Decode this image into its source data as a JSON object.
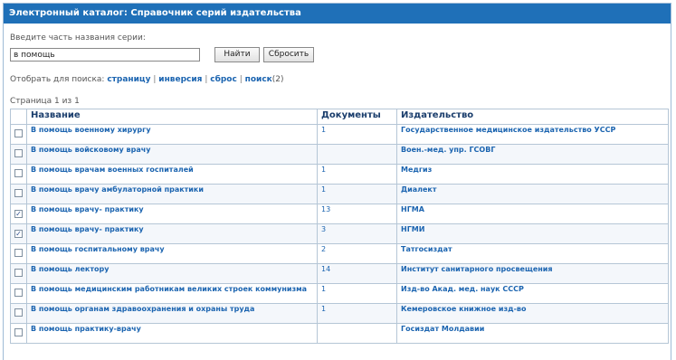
{
  "window": {
    "title": "Электронный каталог: Справочник серий издательства"
  },
  "search": {
    "label": "Введите часть названия серии:",
    "value": "в помощь",
    "find_label": "Найти",
    "reset_label": "Сбросить"
  },
  "filter": {
    "prefix": "Отобрать для поиска:",
    "links": [
      "страницу",
      "инверсия",
      "сброс",
      "поиск"
    ],
    "search_count": "(2)"
  },
  "pagination": {
    "label": "Страница 1 из 1"
  },
  "table": {
    "headers": [
      "Название",
      "Документы",
      "Издательство"
    ],
    "rows": [
      {
        "checked": false,
        "name": "В помощь военному хирургу",
        "docs": "1",
        "publisher": "Государственное медицинское издательство УССР"
      },
      {
        "checked": false,
        "name": "В помощь войсковому врачу",
        "docs": "",
        "publisher": "Воен.-мед. упр. ГСОВГ"
      },
      {
        "checked": false,
        "name": "В помощь врачам военных госпиталей",
        "docs": "1",
        "publisher": "Медгиз"
      },
      {
        "checked": false,
        "name": "В помощь врачу амбулаторной практики",
        "docs": "1",
        "publisher": "Диалект"
      },
      {
        "checked": true,
        "name": "В помощь врачу- практику",
        "docs": "13",
        "publisher": "НГМА"
      },
      {
        "checked": true,
        "name": "В помощь врачу- практику",
        "docs": "3",
        "publisher": "НГМИ"
      },
      {
        "checked": false,
        "name": "В помощь госпитальному врачу",
        "docs": "2",
        "publisher": "Татгосиздат"
      },
      {
        "checked": false,
        "name": "В помощь лектору",
        "docs": "14",
        "publisher": "Институт санитарного просвещения"
      },
      {
        "checked": false,
        "name": "В помощь медицинским работникам великих строек коммунизма",
        "docs": "1",
        "publisher": "Изд-во Акад. мед. наук СССР"
      },
      {
        "checked": false,
        "name": "В помощь органам здравоохранения и охраны труда",
        "docs": "1",
        "publisher": "Кемеровское книжное изд-во"
      },
      {
        "checked": false,
        "name": "В помощь практику-врачу",
        "docs": "",
        "publisher": "Госиздат Молдавии"
      }
    ]
  },
  "colors": {
    "title_bar": "#1f70b8",
    "link": "#1b64b0",
    "border": "#b5c6d6"
  }
}
